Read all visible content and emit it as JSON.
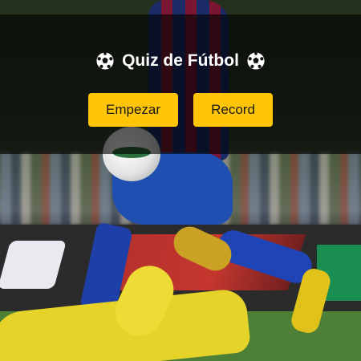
{
  "quiz": {
    "title": "Quiz de Fútbol",
    "title_icon": "soccer-ball-icon"
  },
  "actions": {
    "start_label": "Empezar",
    "record_label": "Record"
  },
  "colors": {
    "button_bg": "#ffc506",
    "overlay_bg": "rgba(0,0,0,0.62)",
    "title_text": "#ffffff"
  }
}
